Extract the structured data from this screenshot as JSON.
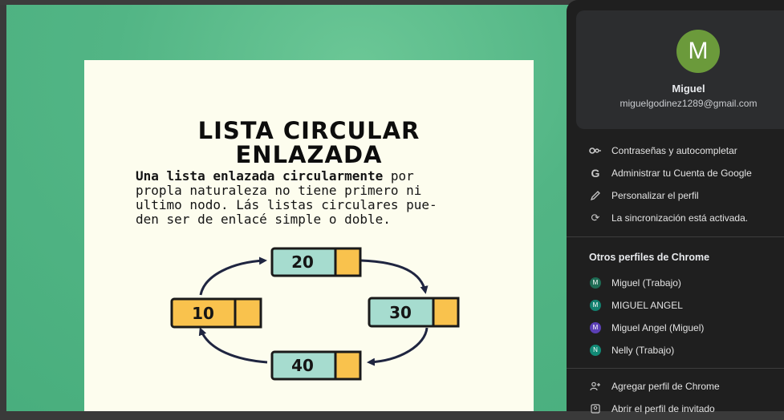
{
  "slide": {
    "title_lines": [
      "LISTA CIRCULAR",
      "ENLAZADA"
    ],
    "text_lines": [
      "Una lista enlazada circularmente por",
      "propla naturaleza no tiene primero ni",
      "ultimo nodo. Lás listas circulares pue-",
      "den ser de enlacé simple o doble."
    ],
    "bold_phrase": "Una lista enlazada circularmente",
    "nodes": [
      "20",
      "30",
      "40",
      "10"
    ]
  },
  "colors": {
    "canvas_bg": "#4fb483",
    "slide_bg": "#fdfdee",
    "node_teal": "#a6dccf",
    "node_yellow": "#f9c24d",
    "panel_bg": "#1f1f1f",
    "card_bg": "#2c2d2f",
    "avatar_green": "#6b9a3b"
  },
  "profile": {
    "avatar_letter": "M",
    "name": "Miguel",
    "email": "miguelgodinez1289@gmail.com"
  },
  "menu": [
    {
      "icon": "key-icon",
      "label": "Contraseñas y autocompletar"
    },
    {
      "icon": "google-icon",
      "label": "Administrar tu Cuenta de Google"
    },
    {
      "icon": "pencil-icon",
      "label": "Personalizar el perfil"
    },
    {
      "icon": "sync-icon",
      "label": "La sincronización está activada."
    }
  ],
  "other_profiles": {
    "title": "Otros perfiles de Chrome",
    "items": [
      {
        "letter": "M",
        "label": "Miguel (Trabajo)",
        "color": "#1e6b54"
      },
      {
        "letter": "M",
        "label": "MIGUEL ANGEL",
        "color": "#12806f"
      },
      {
        "letter": "M",
        "label": "Miguel Angel (Miguel)",
        "color": "#5b3fb5"
      },
      {
        "letter": "N",
        "label": "Nelly (Trabajo)",
        "color": "#118a76"
      }
    ]
  },
  "footer": [
    {
      "icon": "add-person-icon",
      "label": "Agregar perfil de Chrome"
    },
    {
      "icon": "guest-icon",
      "label": "Abrir el perfil de invitado"
    }
  ]
}
